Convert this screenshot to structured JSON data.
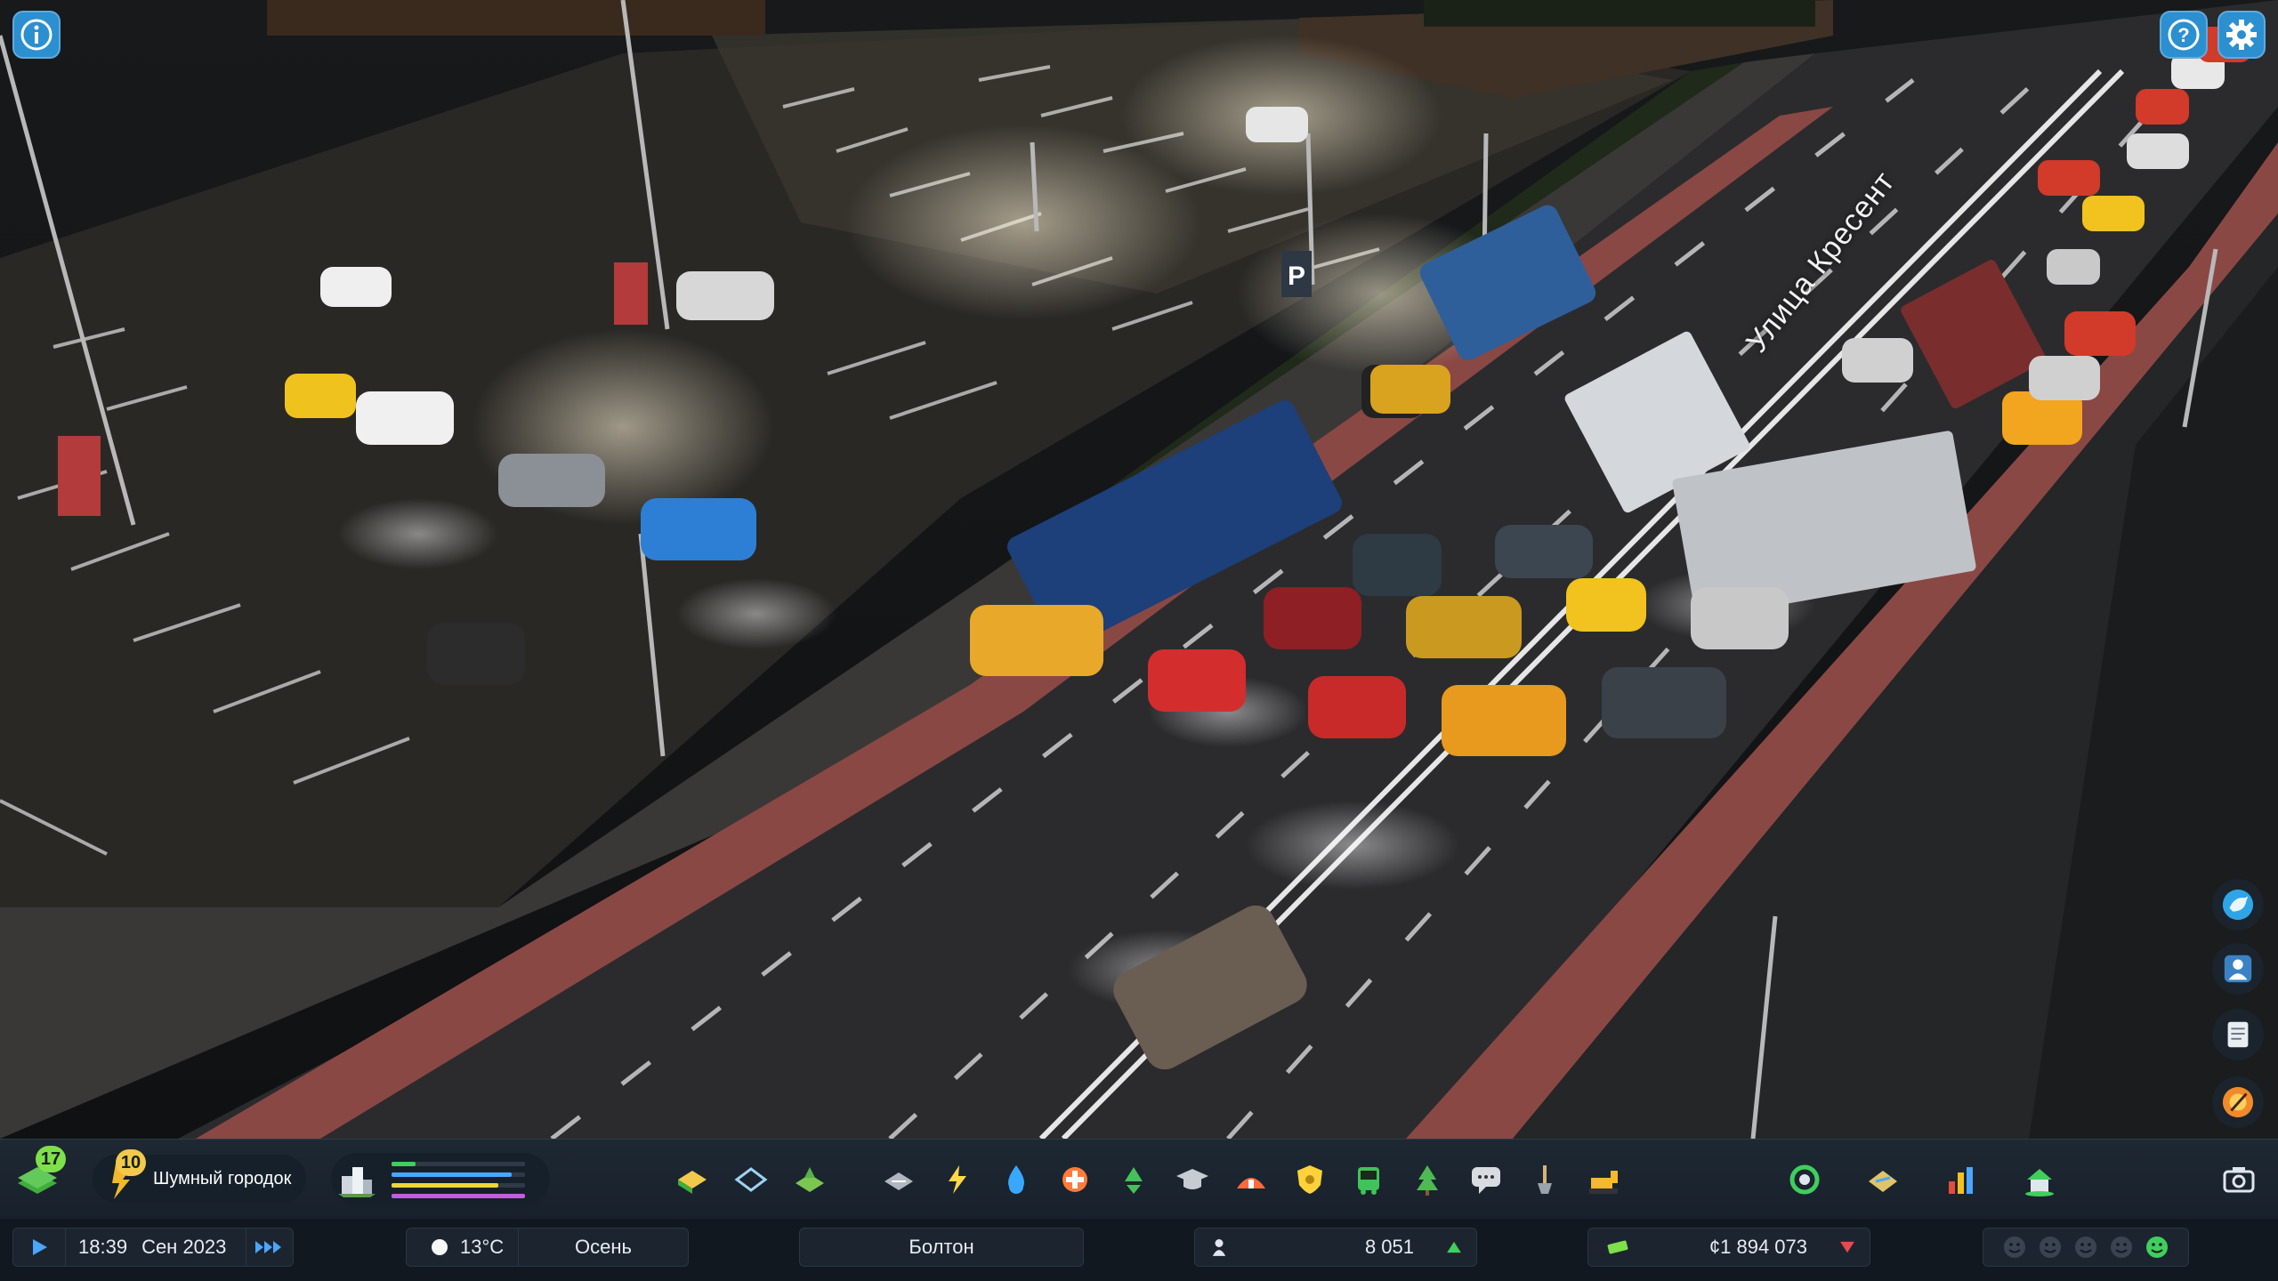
{
  "corner": {
    "info_icon": "info-icon",
    "help_icon": "help-icon",
    "settings_icon": "gear-icon"
  },
  "map": {
    "street_label": "Улица Кресент",
    "parking_sign": "P"
  },
  "side_panel": {
    "items": [
      {
        "name": "chirper-bird-icon"
      },
      {
        "name": "citizen-icon"
      },
      {
        "name": "journal-icon"
      },
      {
        "name": "radio-icon"
      }
    ],
    "photo_mode_icon": "camera-icon"
  },
  "toolbar": {
    "xp_level": "17",
    "milestone_level": "10",
    "milestone_name": "Шумный городок",
    "demand_colors": [
      "#3fcf5c",
      "#4aa6ff",
      "#f0d43a",
      "#c45ce0"
    ],
    "demand_levels": [
      0.18,
      0.9,
      0.8,
      1.0
    ],
    "tools": [
      {
        "name": "zoning-tool",
        "color": "#f2c94c"
      },
      {
        "name": "area-tool",
        "color": "#9ed2f0"
      },
      {
        "name": "landscaping-tool",
        "color": "#7ac74f"
      },
      {
        "name": "roads-tool",
        "color": "#b0b7bf"
      },
      {
        "name": "electricity-tool",
        "color": "#ffd84a"
      },
      {
        "name": "water-tool",
        "color": "#3aa7ff"
      },
      {
        "name": "healthcare-tool",
        "color": "#ff7b3a"
      },
      {
        "name": "garbage-tool",
        "color": "#46c15a"
      },
      {
        "name": "education-tool",
        "color": "#c7ccd2"
      },
      {
        "name": "fire-rescue-tool",
        "color": "#ff6a3a"
      },
      {
        "name": "police-tool",
        "color": "#ffd23a"
      },
      {
        "name": "transport-tool",
        "color": "#3fc35a"
      },
      {
        "name": "parks-tool",
        "color": "#4fba54"
      },
      {
        "name": "communications-tool",
        "color": "#d8dce0"
      },
      {
        "name": "landscaping-shovel-tool",
        "color": "#d5b47a"
      },
      {
        "name": "bulldozer-tool",
        "color": "#f5b82e"
      }
    ],
    "right_tools": [
      {
        "name": "economy-tool",
        "color": "#3fcf5c"
      },
      {
        "name": "map-tool",
        "color": "#e0c36a"
      },
      {
        "name": "statistics-tool",
        "color": "#e64b3c"
      },
      {
        "name": "progression-tool",
        "color": "#3fcf5c"
      }
    ]
  },
  "status": {
    "time": "18:39",
    "date": "Сен 2023",
    "temperature": "13°C",
    "season": "Осень",
    "city": "Болтон",
    "population": "8 051",
    "money": "¢1 894 073",
    "happiness_levels": 5
  }
}
